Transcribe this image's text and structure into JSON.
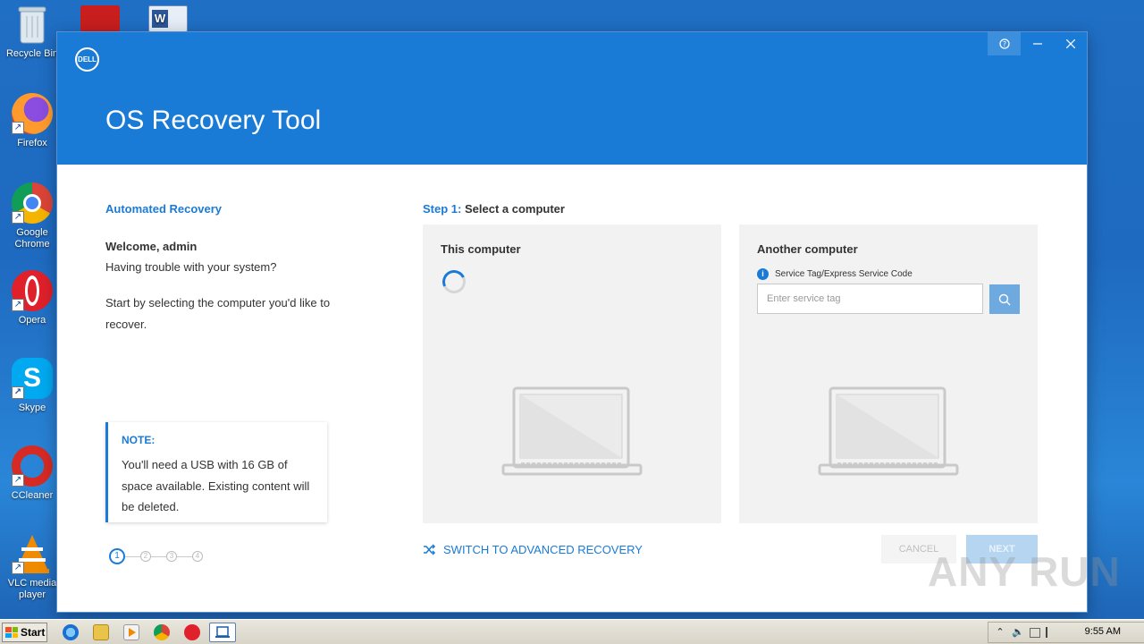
{
  "desktop": {
    "icons": [
      {
        "label": "Recycle Bin",
        "icon": "recycle-bin-icon"
      },
      {
        "label": "Firefox",
        "icon": "firefox-icon"
      },
      {
        "label": "Google Chrome",
        "icon": "chrome-icon"
      },
      {
        "label": "Opera",
        "icon": "opera-icon"
      },
      {
        "label": "Skype",
        "icon": "skype-icon"
      },
      {
        "label": "CCleaner",
        "icon": "ccleaner-icon"
      },
      {
        "label": "VLC media player",
        "icon": "vlc-icon"
      }
    ]
  },
  "window": {
    "logo_text": "DELL",
    "title": "OS Recovery Tool",
    "controls": {
      "help": "?",
      "minimize": "—",
      "close": "✕"
    }
  },
  "left": {
    "section_label": "Automated Recovery",
    "welcome": "Welcome, admin",
    "trouble": "Having trouble with your system?",
    "instruction": "Start by selecting the computer you'd like to recover.",
    "note_title": "NOTE:",
    "note_text": "You'll need a USB with 16 GB of space available. Existing content will be deleted.",
    "steps": [
      "1",
      "2",
      "3",
      "4"
    ],
    "active_step": 1
  },
  "main": {
    "step_prefix": "Step 1:",
    "step_title": "Select a computer",
    "card_this": {
      "title": "This computer"
    },
    "card_another": {
      "title": "Another computer",
      "svc_label": "Service Tag/Express Service Code",
      "svc_placeholder": "Enter service tag",
      "svc_value": ""
    },
    "advanced_link": "SWITCH TO ADVANCED RECOVERY",
    "cancel_label": "CANCEL",
    "next_label": "NEXT"
  },
  "watermark": "ANY RUN",
  "taskbar": {
    "start_label": "Start",
    "clock": "9:55 AM"
  },
  "colors": {
    "accent": "#1a7bd6",
    "header": "#1a7bd6",
    "card_bg": "#f2f2f2"
  }
}
